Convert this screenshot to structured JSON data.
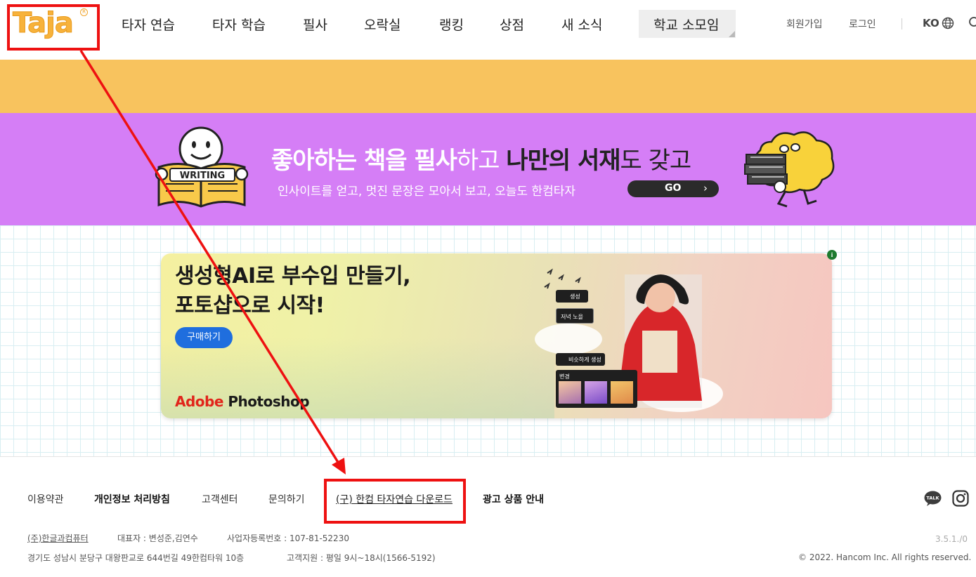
{
  "header": {
    "logo_text": "Taja",
    "logo_reg": "R",
    "nav": [
      "타자 연습",
      "타자 학습",
      "필사",
      "오락실",
      "랭킹",
      "상점",
      "새 소식"
    ],
    "nav_school": "학교 소모임",
    "signup": "회원가입",
    "login": "로그인",
    "lang": "KO"
  },
  "banner": {
    "title_1": "좋아하는 책을 필사",
    "title_2": "하고 ",
    "title_3": "나만의 서재",
    "title_4": "도 갖고",
    "subtitle": "인사이트를 얻고, 멋진 문장은 모아서 보고, 오늘도 한컴타자",
    "go": "GO",
    "go_arrow": "›",
    "book_label": "WRITING"
  },
  "ad": {
    "headline_1": "생성형AI로 부수입 만들기,",
    "headline_2": "포토샵으로 시작!",
    "buy": "구매하기",
    "brand_red": "Adobe",
    "brand_dark": " Photoshop",
    "chip_generate": "생성",
    "chip_sunset": "저녁 노을",
    "chip_similar": "비슷하게 생성",
    "chip_change": "변경",
    "info": "i"
  },
  "footer": {
    "links": [
      "이용약관",
      "개인정보 처리방침",
      "고객센터",
      "문의하기",
      "(구) 한컴 타자연습 다운로드",
      "광고 상품 안내"
    ],
    "company": "(주)한글과컴퓨터",
    "ceo": "대표자 : 변성준,김연수",
    "biz_no": "사업자등록번호 : 107-81-52230",
    "address": "경기도 성남시 분당구 대왕판교로 644번길 49한컴타워 10층",
    "support": "고객지원 : 평일 9시~18시(1566-5192)",
    "version": "3.5.1./0",
    "copyright": "© 2022. Hancom Inc. All rights reserved.",
    "talk": "TALK"
  },
  "colors": {
    "brand_orange": "#f7b23b",
    "band_yellow": "#f8c35e",
    "band_purple": "#d57ef6",
    "annotation_red": "#ee1111",
    "buy_blue": "#1f6ede"
  },
  "icons": [
    "globe-icon",
    "search-icon",
    "info-icon",
    "kakao-talk-icon",
    "instagram-icon",
    "chevron-right-icon"
  ]
}
